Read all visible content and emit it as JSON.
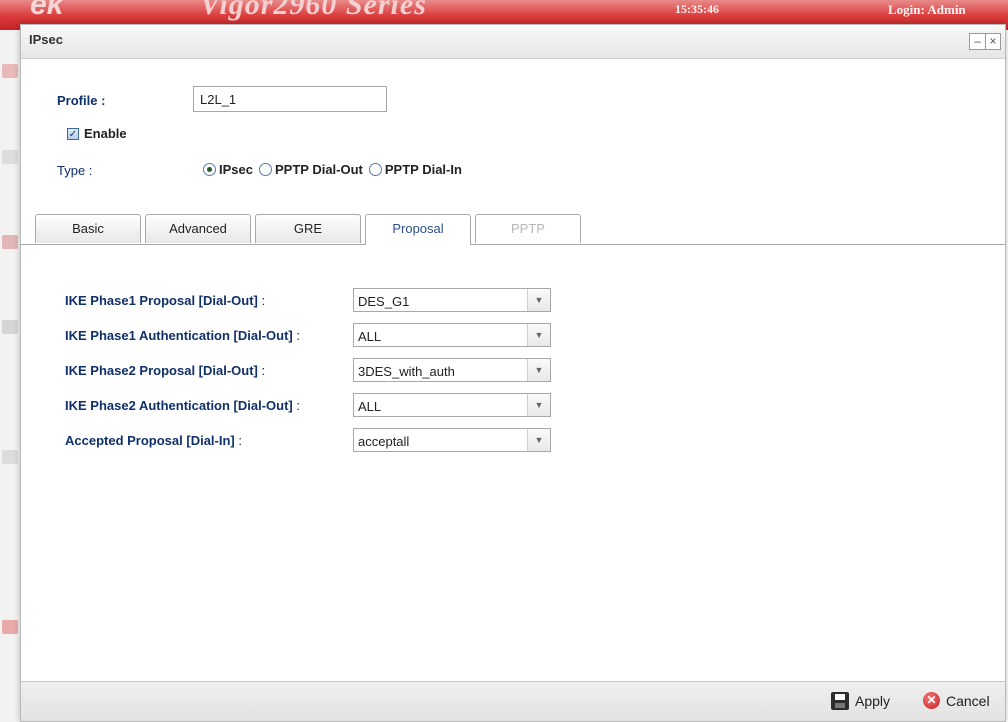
{
  "background": {
    "logo_text": "ek",
    "model": "Vigor2960 Series",
    "time": "15:35:46",
    "login": "Login: Admin"
  },
  "window": {
    "title": "IPsec",
    "minimize": "–",
    "close": "×"
  },
  "profile": {
    "label": "Profile :",
    "value": "L2L_1"
  },
  "enable": {
    "label": "Enable",
    "checked": true,
    "check_glyph": "✓"
  },
  "type": {
    "label": "Type :",
    "options": [
      {
        "label": "IPsec",
        "selected": true
      },
      {
        "label": "PPTP Dial-Out",
        "selected": false
      },
      {
        "label": "PPTP Dial-In",
        "selected": false
      }
    ]
  },
  "tabs": [
    {
      "label": "Basic"
    },
    {
      "label": "Advanced"
    },
    {
      "label": "GRE"
    },
    {
      "label": "Proposal",
      "active": true
    },
    {
      "label": "PPTP",
      "disabled": true
    }
  ],
  "proposal_fields": [
    {
      "label": "IKE Phase1 Proposal [Dial-Out]",
      "colon": " :",
      "value": "DES_G1"
    },
    {
      "label": "IKE Phase1 Authentication [Dial-Out]",
      "colon": " :",
      "value": "ALL"
    },
    {
      "label": "IKE Phase2 Proposal [Dial-Out]",
      "colon": " :",
      "value": "3DES_with_auth"
    },
    {
      "label": "IKE Phase2 Authentication [Dial-Out]",
      "colon": " :",
      "value": "ALL"
    },
    {
      "label": "Accepted Proposal [Dial-In]",
      "colon": " :",
      "value": "acceptall"
    }
  ],
  "footer": {
    "apply_label": "Apply",
    "cancel_label": "Cancel",
    "cancel_glyph": "✕"
  },
  "colors": {
    "header_red": "#d93a3a",
    "label_blue": "#10306a",
    "tab_active_text": "#2c4f8a"
  },
  "icons": {
    "save": "save-icon",
    "cancel": "cancel-icon",
    "dropdown": "chevron-down-icon"
  }
}
